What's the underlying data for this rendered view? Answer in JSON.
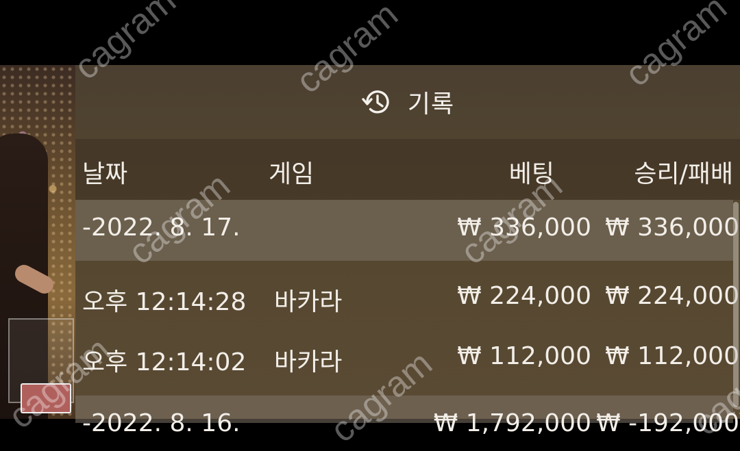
{
  "header": {
    "icon": "history-icon",
    "title": "기록"
  },
  "columns": {
    "date": "날짜",
    "game": "게임",
    "bet": "베팅",
    "result": "승리/패배"
  },
  "rows": [
    {
      "type": "date",
      "date": "-2022. 8. 17.",
      "game": "",
      "bet": "₩ 336,000",
      "result": "₩ 336,000"
    },
    {
      "type": "entry",
      "date": "오후 12:14:28",
      "game": "바카라",
      "bet": "₩ 224,000",
      "result": "₩ 224,000"
    },
    {
      "type": "entry",
      "date": "오후 12:14:02",
      "game": "바카라",
      "bet": "₩ 112,000",
      "result": "₩ 112,000"
    },
    {
      "type": "date",
      "date": "-2022. 8. 16.",
      "game": "",
      "bet": "₩ 1,792,000",
      "result": "₩ -192,000"
    }
  ],
  "watermark": "cagram",
  "colors": {
    "panel": "#55472f",
    "text": "#f1ede6",
    "date_row": "#7d7366"
  }
}
